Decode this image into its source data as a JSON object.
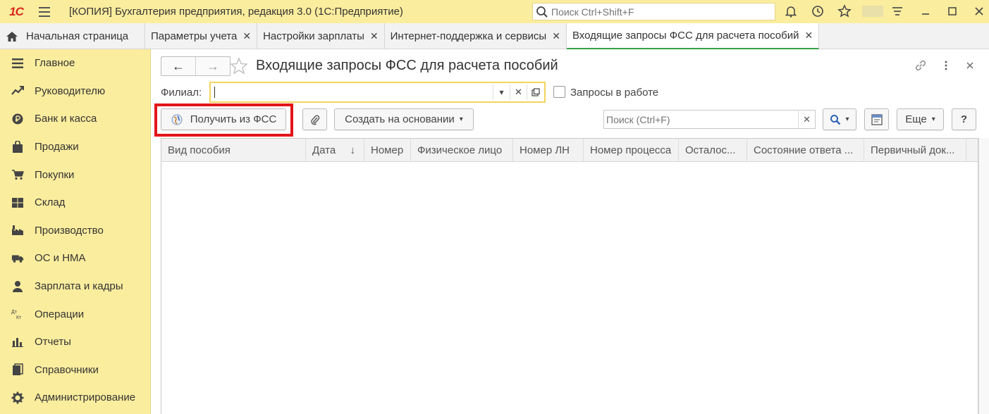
{
  "titlebar": {
    "logo": "1С",
    "title": "[КОПИЯ] Бухгалтерия предприятия, редакция 3.0  (1С:Предприятие)",
    "search_placeholder": "Поиск Ctrl+Shift+F"
  },
  "tabs": [
    {
      "label": "Начальная страница"
    },
    {
      "label": "Параметры учета"
    },
    {
      "label": "Настройки зарплаты"
    },
    {
      "label": "Интернет-поддержка и сервисы"
    },
    {
      "label": "Входящие запросы ФСС для расчета пособий"
    }
  ],
  "tab_close": "✕",
  "sidebar": {
    "items": [
      {
        "label": "Главное",
        "icon": "menu-icon"
      },
      {
        "label": "Руководителю",
        "icon": "trend-icon"
      },
      {
        "label": "Банк и касса",
        "icon": "coin-icon"
      },
      {
        "label": "Продажи",
        "icon": "bag-icon"
      },
      {
        "label": "Покупки",
        "icon": "cart-icon"
      },
      {
        "label": "Склад",
        "icon": "warehouse-icon"
      },
      {
        "label": "Производство",
        "icon": "factory-icon"
      },
      {
        "label": "ОС и НМА",
        "icon": "truck-icon"
      },
      {
        "label": "Зарплата и кадры",
        "icon": "person-icon"
      },
      {
        "label": "Операции",
        "icon": "dt-kt-icon"
      },
      {
        "label": "Отчеты",
        "icon": "bar-chart-icon"
      },
      {
        "label": "Справочники",
        "icon": "books-icon"
      },
      {
        "label": "Администрирование",
        "icon": "gear-icon"
      }
    ]
  },
  "form": {
    "title": "Входящие запросы ФСС для расчета пособий",
    "filial_label": "Филиал:",
    "filial_value": "",
    "in_work_label": "Запросы в работе",
    "in_work_checked": false,
    "btn_get_fss": "Получить из ФСС",
    "btn_create_based": "Создать на основании",
    "search_placeholder": "Поиск (Ctrl+F)",
    "btn_more": "Еще",
    "btn_help": "?"
  },
  "table": {
    "columns": [
      {
        "label": "Вид пособия"
      },
      {
        "label": "Дата"
      },
      {
        "label": "Номер"
      },
      {
        "label": "Физическое лицо"
      },
      {
        "label": "Номер ЛН"
      },
      {
        "label": "Номер процесса"
      },
      {
        "label": "Осталос..."
      },
      {
        "label": "Состояние ответа ..."
      },
      {
        "label": "Первичный док..."
      }
    ],
    "sort_indicator": "↓",
    "rows": []
  },
  "colors": {
    "panel_yellow": "#fbed9e",
    "highlight_red": "#e3141a",
    "active_tab_underline": "#36a14a",
    "field_focus": "#f3d35c"
  }
}
